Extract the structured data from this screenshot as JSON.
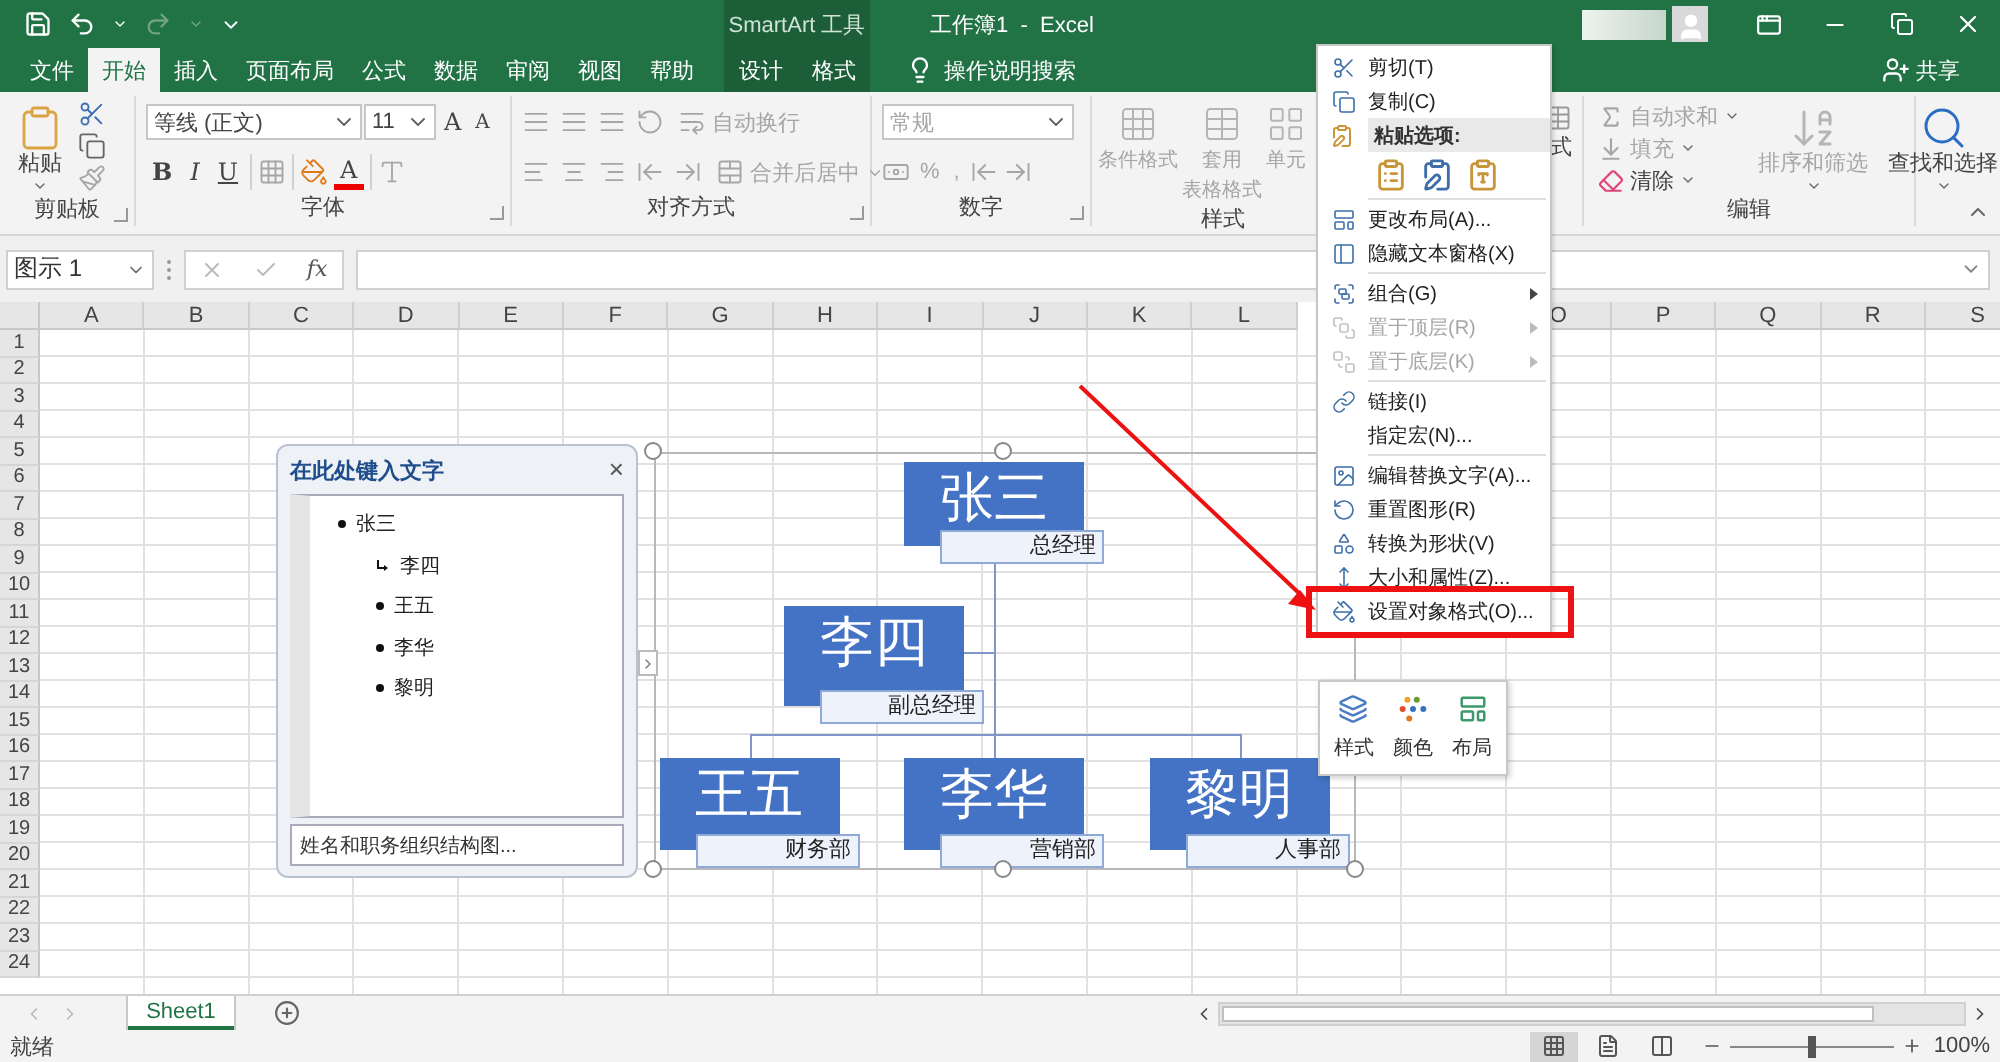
{
  "title_bar": {
    "context_title": "SmartArt 工具",
    "title": "工作簿1  -  Excel"
  },
  "tabs": [
    {
      "label": "文件",
      "selected": false,
      "contextual": false
    },
    {
      "label": "开始",
      "selected": true,
      "contextual": false
    },
    {
      "label": "插入",
      "selected": false,
      "contextual": false
    },
    {
      "label": "页面布局",
      "selected": false,
      "contextual": false
    },
    {
      "label": "公式",
      "selected": false,
      "contextual": false
    },
    {
      "label": "数据",
      "selected": false,
      "contextual": false
    },
    {
      "label": "审阅",
      "selected": false,
      "contextual": false
    },
    {
      "label": "视图",
      "selected": false,
      "contextual": false
    },
    {
      "label": "帮助",
      "selected": false,
      "contextual": false
    },
    {
      "label": "设计",
      "selected": false,
      "contextual": true
    },
    {
      "label": "格式",
      "selected": false,
      "contextual": true
    }
  ],
  "tell_me": "操作说明搜索",
  "share": "共享",
  "ribbon": {
    "groups": [
      {
        "kind": "clipboard",
        "label": "剪贴板",
        "paste": "粘贴"
      },
      {
        "kind": "font",
        "label": "字体",
        "font_name": "等线 (正文)",
        "font_size": "11",
        "grow": "A",
        "shrink": "A",
        "bold": "B",
        "italic": "I",
        "underline": "U",
        "font_color": "A"
      },
      {
        "kind": "alignment",
        "label": "对齐方式",
        "wrap": "自动换行",
        "merge": "合并后居中",
        "disabled": true
      },
      {
        "kind": "number",
        "label": "数字",
        "format": "常规",
        "percent": "%",
        "comma": ",",
        "disabled": true
      },
      {
        "kind": "styles",
        "label": "样式",
        "buttons": [
          {
            "lines": [
              "条件格式"
            ],
            "disabled": true
          },
          {
            "lines": [
              "套用",
              "表格格式"
            ],
            "disabled": true
          },
          {
            "lines": [
              "单元"
            ],
            "disabled": true
          }
        ]
      },
      {
        "kind": "cells",
        "partial": "式"
      },
      {
        "kind": "editing",
        "label": "编辑",
        "items": [
          {
            "label": "自动求和",
            "disabled": true
          },
          {
            "label": "填充",
            "disabled": true
          },
          {
            "label": "清除",
            "disabled": false
          }
        ],
        "buttons": [
          {
            "label": "排序和筛选",
            "disabled": true
          },
          {
            "label": "查找和选择",
            "disabled": false
          }
        ]
      }
    ]
  },
  "formula_bar": {
    "name_box": "图示 1",
    "fx": "fx"
  },
  "sheet": {
    "columns_left": [
      "A",
      "B",
      "C",
      "D",
      "E",
      "F",
      "G",
      "H",
      "I",
      "J",
      "K",
      "L"
    ],
    "columns_right": [
      "O",
      "P",
      "Q",
      "R",
      "S"
    ],
    "rows": [
      "1",
      "2",
      "3",
      "4",
      "5",
      "6",
      "7",
      "8",
      "9",
      "10",
      "11",
      "12",
      "13",
      "14",
      "15",
      "16",
      "17",
      "18",
      "19",
      "20",
      "21",
      "22",
      "23",
      "24"
    ]
  },
  "text_pane": {
    "title": "在此处键入文字",
    "close": "×",
    "items": [
      {
        "text": "张三",
        "kind": "bullet",
        "children": [
          {
            "text": "李四",
            "kind": "assistant"
          },
          {
            "text": "王五",
            "kind": "bullet"
          },
          {
            "text": "李华",
            "kind": "bullet"
          },
          {
            "text": "黎明",
            "kind": "bullet"
          }
        ]
      }
    ],
    "footer": "姓名和职务组织结构图..."
  },
  "org_chart": {
    "root": {
      "name": "张三",
      "title": "总经理",
      "children": [
        {
          "name": "李四",
          "title": "副总经理",
          "kind": "assistant"
        },
        {
          "name": "王五",
          "title": "财务部",
          "kind": "staff"
        },
        {
          "name": "李华",
          "title": "营销部",
          "kind": "staff"
        },
        {
          "name": "黎明",
          "title": "人事部",
          "kind": "staff"
        }
      ]
    }
  },
  "context_menu": {
    "items": [
      {
        "kind": "item",
        "label": "剪切(T)",
        "disabled": false,
        "submenu": false,
        "highlighted": false
      },
      {
        "kind": "item",
        "label": "复制(C)",
        "disabled": false,
        "submenu": false,
        "highlighted": false
      },
      {
        "kind": "header",
        "label": "粘贴选项:"
      },
      {
        "kind": "paste_options"
      },
      {
        "kind": "separator"
      },
      {
        "kind": "item",
        "label": "更改布局(A)...",
        "disabled": false,
        "submenu": false,
        "highlighted": false
      },
      {
        "kind": "item",
        "label": "隐藏文本窗格(X)",
        "disabled": false,
        "submenu": false,
        "highlighted": false
      },
      {
        "kind": "separator"
      },
      {
        "kind": "item",
        "label": "组合(G)",
        "disabled": false,
        "submenu": true,
        "highlighted": false
      },
      {
        "kind": "item",
        "label": "置于顶层(R)",
        "disabled": true,
        "submenu": true,
        "highlighted": false
      },
      {
        "kind": "item",
        "label": "置于底层(K)",
        "disabled": true,
        "submenu": true,
        "highlighted": false
      },
      {
        "kind": "separator"
      },
      {
        "kind": "item",
        "label": "链接(I)",
        "disabled": false,
        "submenu": false,
        "highlighted": false
      },
      {
        "kind": "item",
        "label": "指定宏(N)...",
        "disabled": false,
        "submenu": false,
        "highlighted": false
      },
      {
        "kind": "separator"
      },
      {
        "kind": "item",
        "label": "编辑替换文字(A)...",
        "disabled": false,
        "submenu": false,
        "highlighted": false
      },
      {
        "kind": "item",
        "label": "重置图形(R)",
        "disabled": false,
        "submenu": false,
        "highlighted": false
      },
      {
        "kind": "item",
        "label": "转换为形状(V)",
        "disabled": false,
        "submenu": false,
        "highlighted": false
      },
      {
        "kind": "item",
        "label": "大小和属性(Z)...",
        "disabled": false,
        "submenu": false,
        "highlighted": false
      },
      {
        "kind": "item",
        "label": "设置对象格式(O)...",
        "disabled": false,
        "submenu": false,
        "highlighted": true
      }
    ]
  },
  "mini_toolbar": {
    "buttons": [
      "样式",
      "颜色",
      "布局"
    ]
  },
  "sheet_tabs": [
    {
      "label": "Sheet1",
      "selected": true
    }
  ],
  "status_bar": {
    "status": "就绪",
    "zoom": "100%",
    "zoom_slider": {
      "level": 0.5
    }
  }
}
